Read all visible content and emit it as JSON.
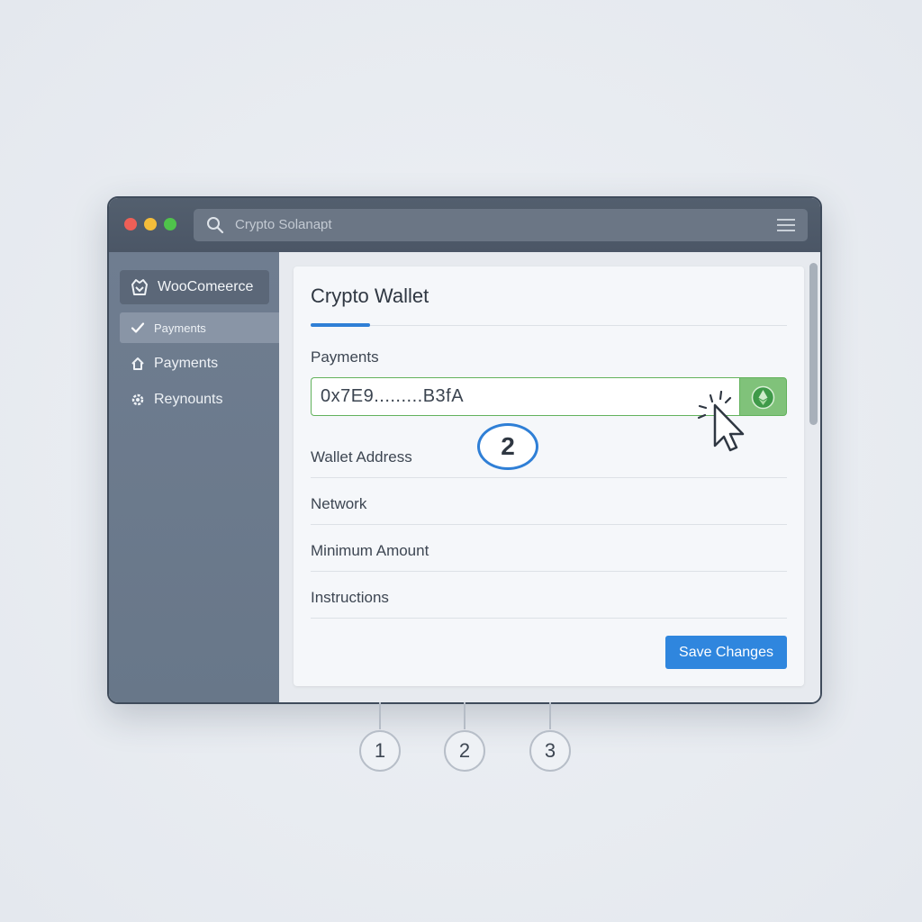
{
  "window": {
    "address_bar": {
      "text": "Crypto Solanapt"
    }
  },
  "sidebar": {
    "brand": "WooComeerce",
    "items": [
      {
        "label": "Payments",
        "active": true
      },
      {
        "label": "Payments",
        "active": false
      },
      {
        "label": "Reynounts",
        "active": false
      }
    ]
  },
  "panel": {
    "title": "Crypto Wallet",
    "field_label": "Payments",
    "wallet_value": "0x7E9.........B3fA",
    "step_callout": "2",
    "rows": [
      {
        "label": "Wallet Address"
      },
      {
        "label": "Network"
      },
      {
        "label": "Minimum Amount"
      },
      {
        "label": "Instructions"
      }
    ],
    "save_label": "Save Changes"
  },
  "steps": [
    "1",
    "2",
    "3"
  ],
  "colors": {
    "accent": "#2f86de",
    "input_border": "#62b25c",
    "eth_button": "#80c27a",
    "titlebar": "#4b5666",
    "sidebar": "#6f7d90"
  },
  "icons": {
    "address_bar": "search-icon",
    "titlebar_right": "menu-icon",
    "brand": "woocommerce-icon",
    "nav": [
      "check-icon",
      "home-icon",
      "gear-icon"
    ],
    "input_action": "ethereum-icon",
    "pointer": "cursor-icon"
  }
}
